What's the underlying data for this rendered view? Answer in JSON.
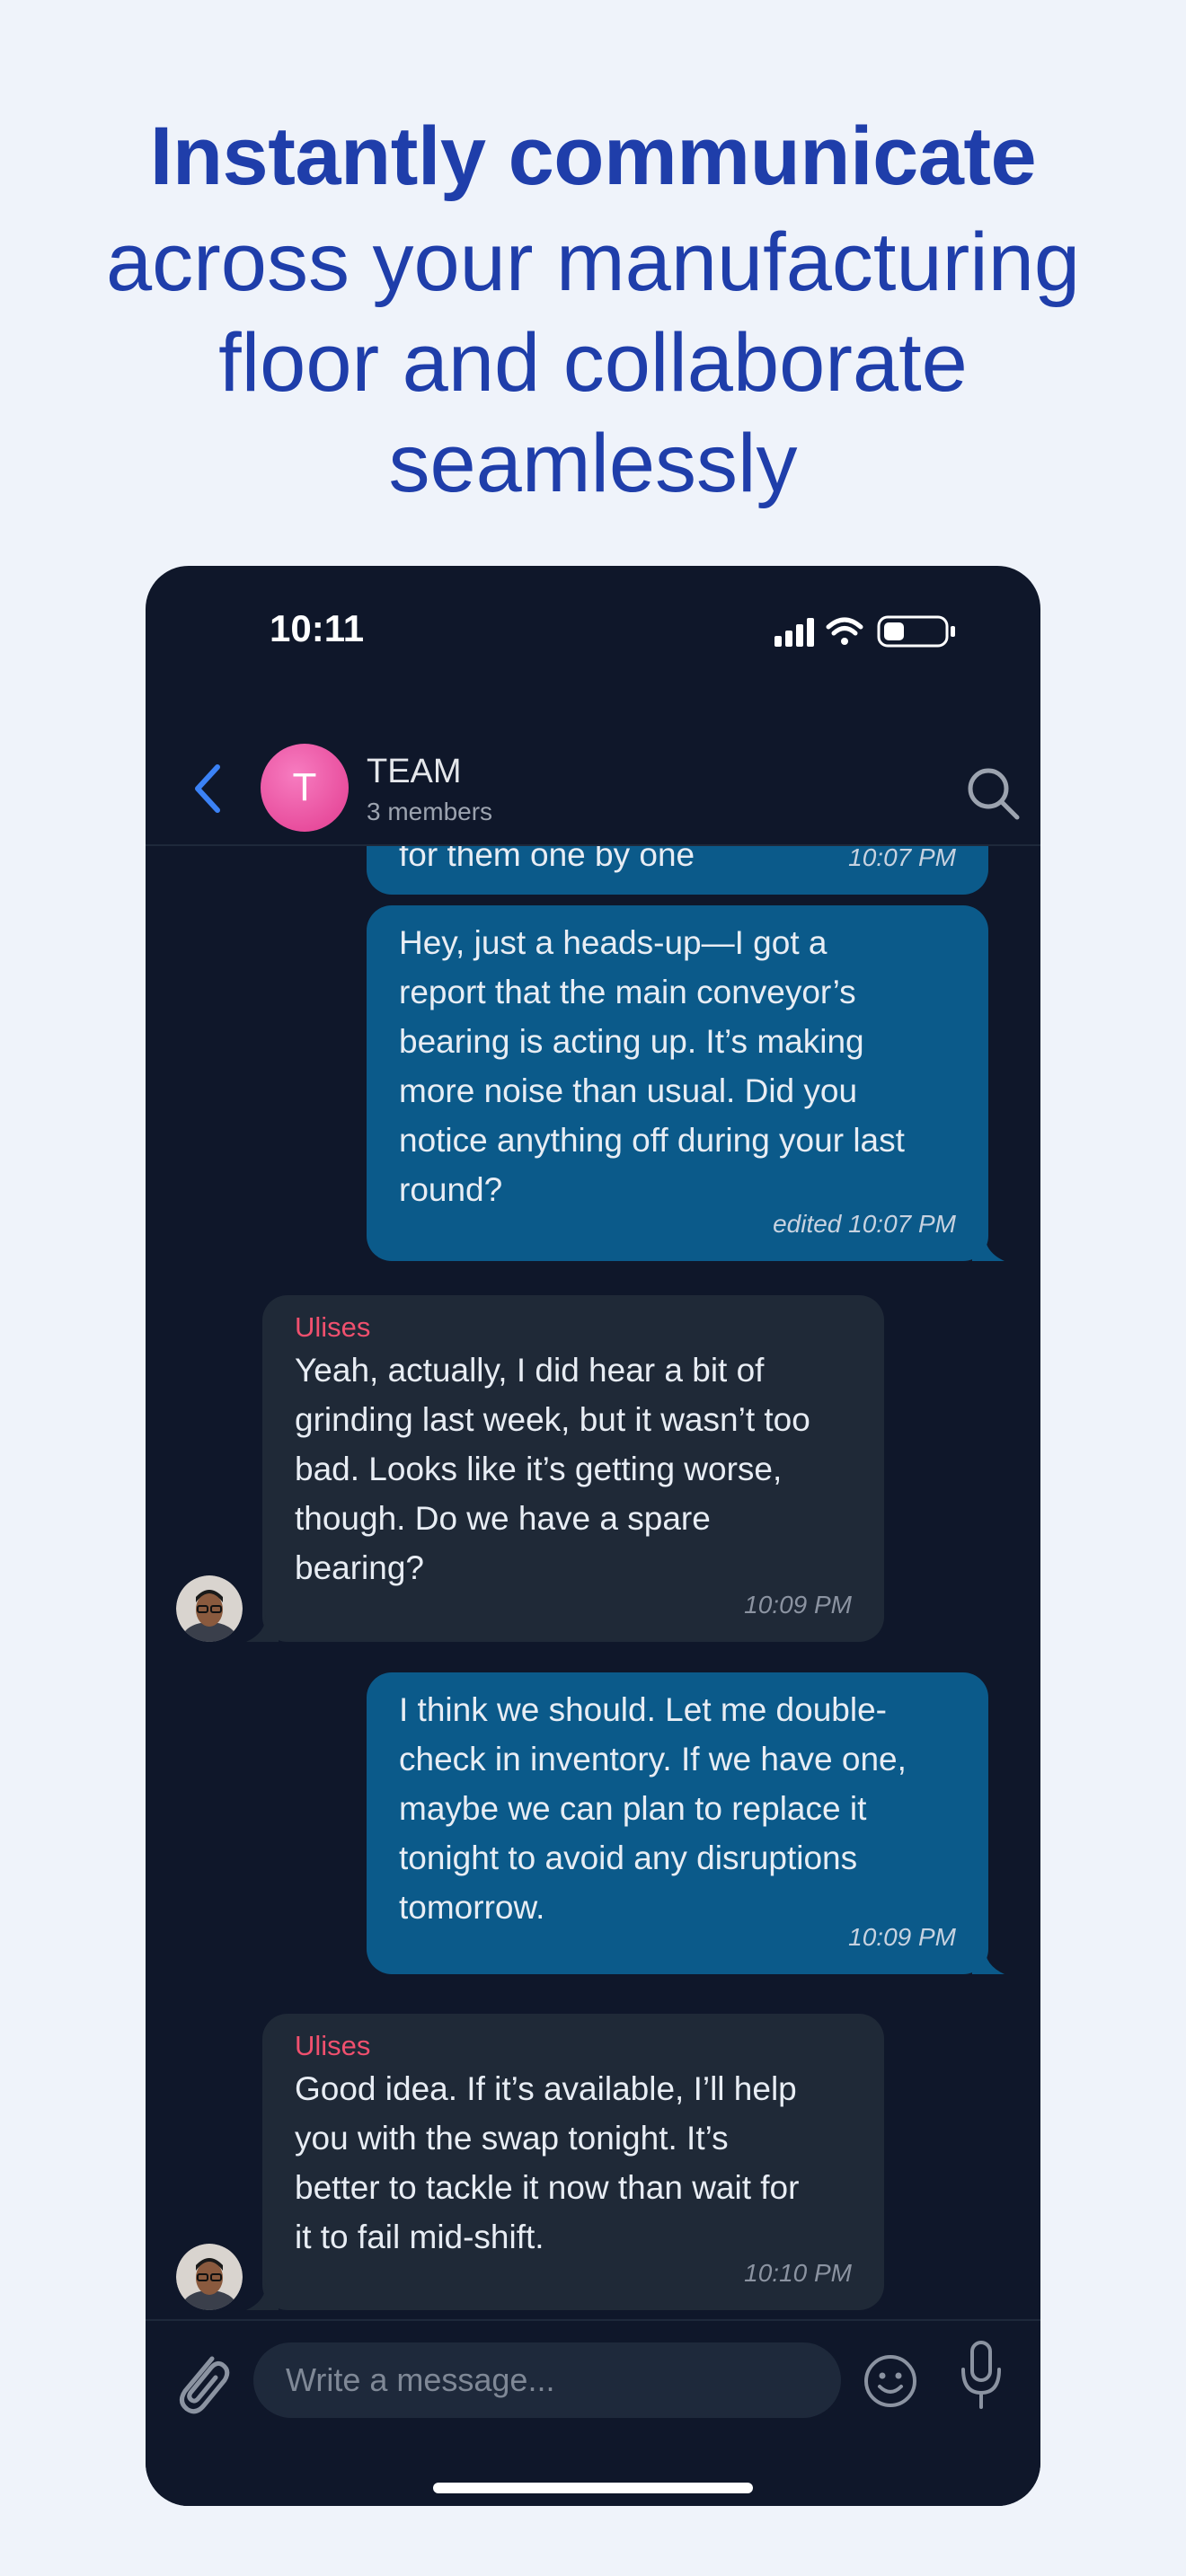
{
  "headline": {
    "bold": "Instantly communicate",
    "lines": [
      "across your manufacturing",
      "floor and collaborate",
      "seamlessly"
    ]
  },
  "status_bar": {
    "time": "10:11"
  },
  "header": {
    "avatar_letter": "T",
    "title": "TEAM",
    "subtitle": "3 members",
    "avatar_color": "#ee4f9f"
  },
  "messages": [
    {
      "direction": "out",
      "lines": [
        "for them one by one"
      ],
      "time": "10:07 PM"
    },
    {
      "direction": "out",
      "lines": [
        "Hey, just a heads-up—I got a",
        "report that the main conveyor’s",
        "bearing is acting up. It’s making",
        "more noise than usual. Did you",
        "notice anything off during your last",
        "round?"
      ],
      "time": "edited 10:07 PM"
    },
    {
      "direction": "in",
      "sender": "Ulises",
      "lines": [
        "Yeah, actually, I did hear a bit of",
        "grinding last week, but it wasn’t too",
        "bad. Looks like it’s getting worse,",
        "though. Do we have a spare",
        "bearing?"
      ],
      "time": "10:09 PM"
    },
    {
      "direction": "out",
      "lines": [
        "I think we should. Let me double-",
        "check in inventory. If we have one,",
        "maybe we can plan to replace it",
        "tonight to avoid any disruptions",
        "tomorrow."
      ],
      "time": "10:09 PM"
    },
    {
      "direction": "in",
      "sender": "Ulises",
      "lines": [
        "Good idea. If it’s available, I’ll help",
        "you with the swap tonight. It’s",
        "better to tackle it now than wait for",
        "it to fail mid-shift."
      ],
      "time": "10:10 PM"
    }
  ],
  "composer": {
    "placeholder": "Write a message..."
  },
  "colors": {
    "outgoing_bubble": "#0b5a8a",
    "incoming_bubble": "#1f2937",
    "sender_name": "#f0506e",
    "accent": "#3b82f6"
  }
}
